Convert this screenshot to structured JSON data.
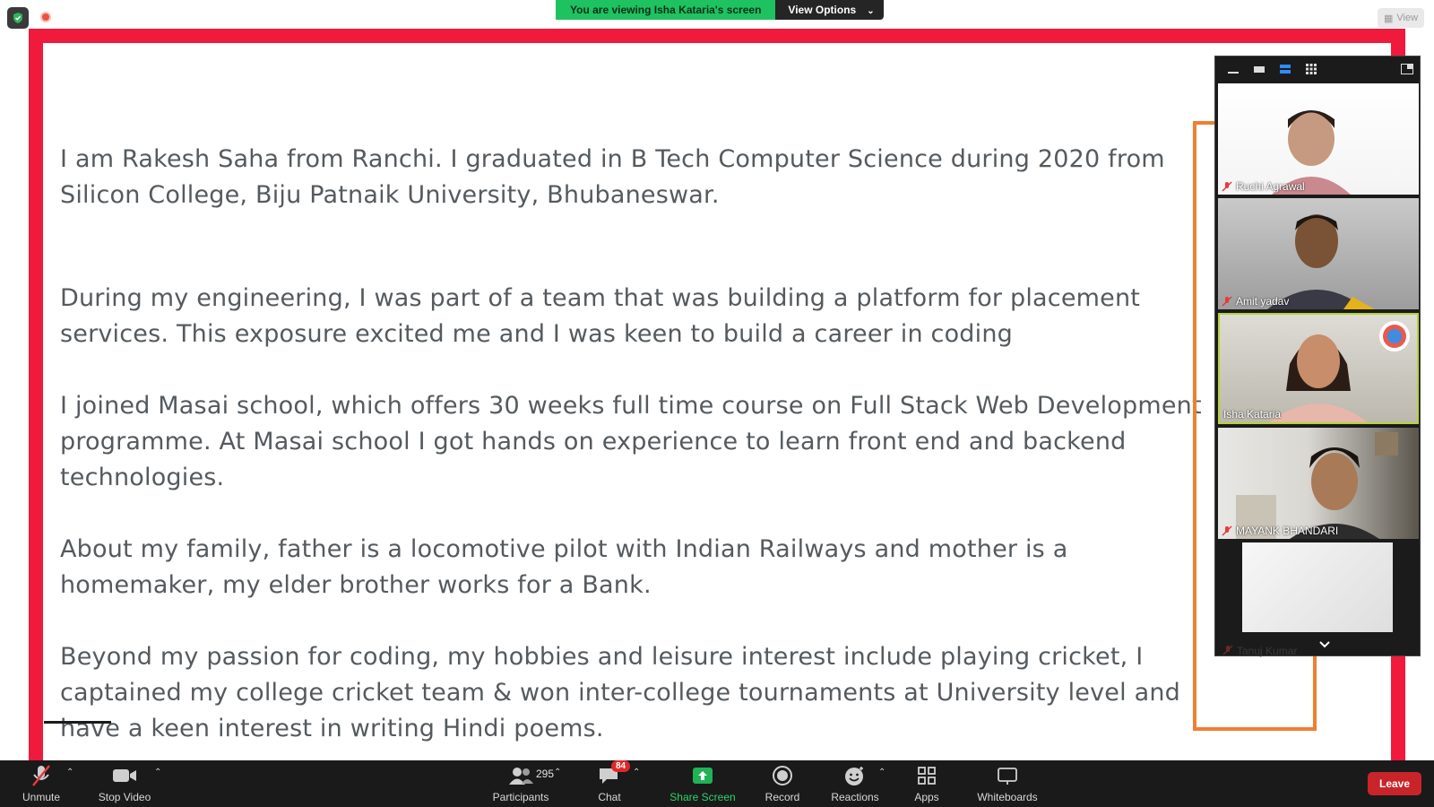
{
  "banner": {
    "viewing_text": "You are viewing Isha Kataria's screen",
    "view_options_label": "View Options",
    "view_button_label": "View"
  },
  "slide": {
    "paragraphs": [
      "I am Rakesh Saha from Ranchi. I graduated in B Tech Computer Science during 2020 from Silicon College, Biju Patnaik University, Bhubaneswar.",
      "During my engineering, I was part of a team that was building a platform for placement services. This exposure excited me and I was keen to build a career in coding",
      "I joined Masai school, which offers 30 weeks full time course on Full Stack Web Development programme. At Masai school I got hands on experience to learn front end and backend technologies.",
      "About my family, father is a locomotive pilot with Indian Railways and mother is a homemaker, my elder brother works for a Bank.",
      "Beyond my passion for coding, my hobbies and leisure interest include playing cricket, I captained my college cricket team & won inter-college tournaments at University level and have a keen interest in writing Hindi poems."
    ]
  },
  "gallery": {
    "participants": [
      {
        "name": "Ruchi Agrawal",
        "muted": true
      },
      {
        "name": "Amit yadav",
        "muted": true
      },
      {
        "name": "Isha Kataria",
        "muted": false
      },
      {
        "name": "MAYANK BHANDARI",
        "muted": true
      },
      {
        "name": "Tanuj Kumar",
        "muted": true
      }
    ]
  },
  "toolbar": {
    "unmute": "Unmute",
    "stop_video": "Stop Video",
    "participants": "Participants",
    "participants_count": "295",
    "chat": "Chat",
    "chat_badge": "84",
    "share_screen": "Share Screen",
    "record": "Record",
    "reactions": "Reactions",
    "apps": "Apps",
    "whiteboards": "Whiteboards",
    "leave": "Leave"
  },
  "colors": {
    "share_border": "#ef1a3c",
    "annotation_orange": "#f07f32",
    "viewing_green": "#1ec260",
    "leave_red": "#c9242a"
  }
}
